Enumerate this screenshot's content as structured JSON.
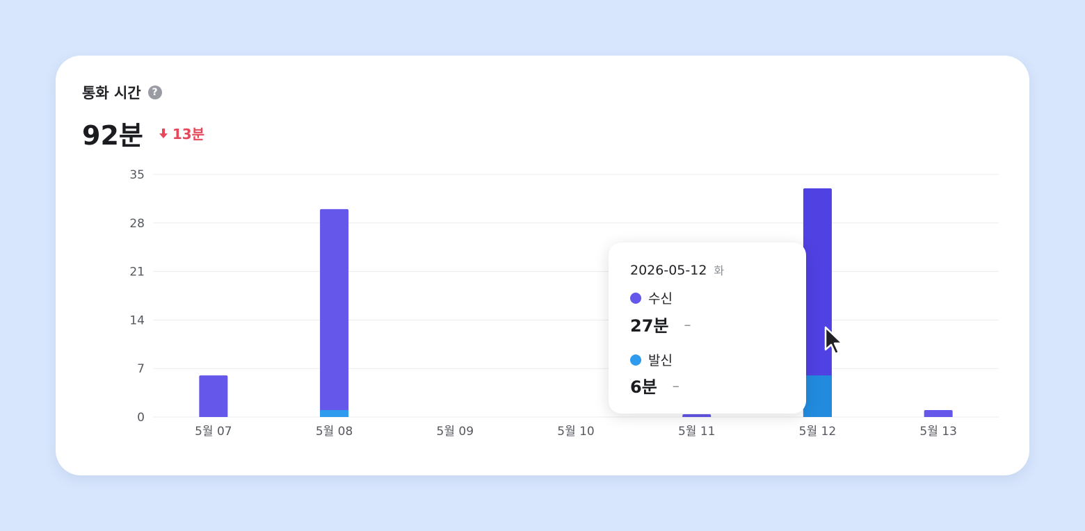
{
  "card": {
    "title": "통화 시간",
    "help_icon": "?",
    "total": "92분",
    "delta": "13분",
    "delta_icon": "arrow-down-icon"
  },
  "colors": {
    "incoming": "#6457ea",
    "incoming_active": "#5041e3",
    "outgoing": "#2f9bee",
    "outgoing_active": "#228bde",
    "delta": "#e5485b",
    "grid": "#ececef"
  },
  "chart_data": {
    "type": "bar",
    "stacked": true,
    "categories": [
      "5월 07",
      "5월 08",
      "5월 09",
      "5월 10",
      "5월 11",
      "5월 12",
      "5월 13"
    ],
    "series": [
      {
        "name": "발신",
        "values": [
          0,
          1,
          0,
          0,
          0,
          6,
          0
        ]
      },
      {
        "name": "수신",
        "values": [
          6,
          29,
          0,
          0,
          0.4,
          27,
          1
        ]
      }
    ],
    "yticks": [
      0,
      7,
      14,
      21,
      28,
      35
    ],
    "ylim": [
      0,
      35
    ],
    "grid": true,
    "highlighted_index": 5
  },
  "tooltip": {
    "date": "2026-05-12",
    "day": "화",
    "items": [
      {
        "label": "수신",
        "value": "27분",
        "change": "–"
      },
      {
        "label": "발신",
        "value": "6분",
        "change": "–"
      }
    ]
  }
}
